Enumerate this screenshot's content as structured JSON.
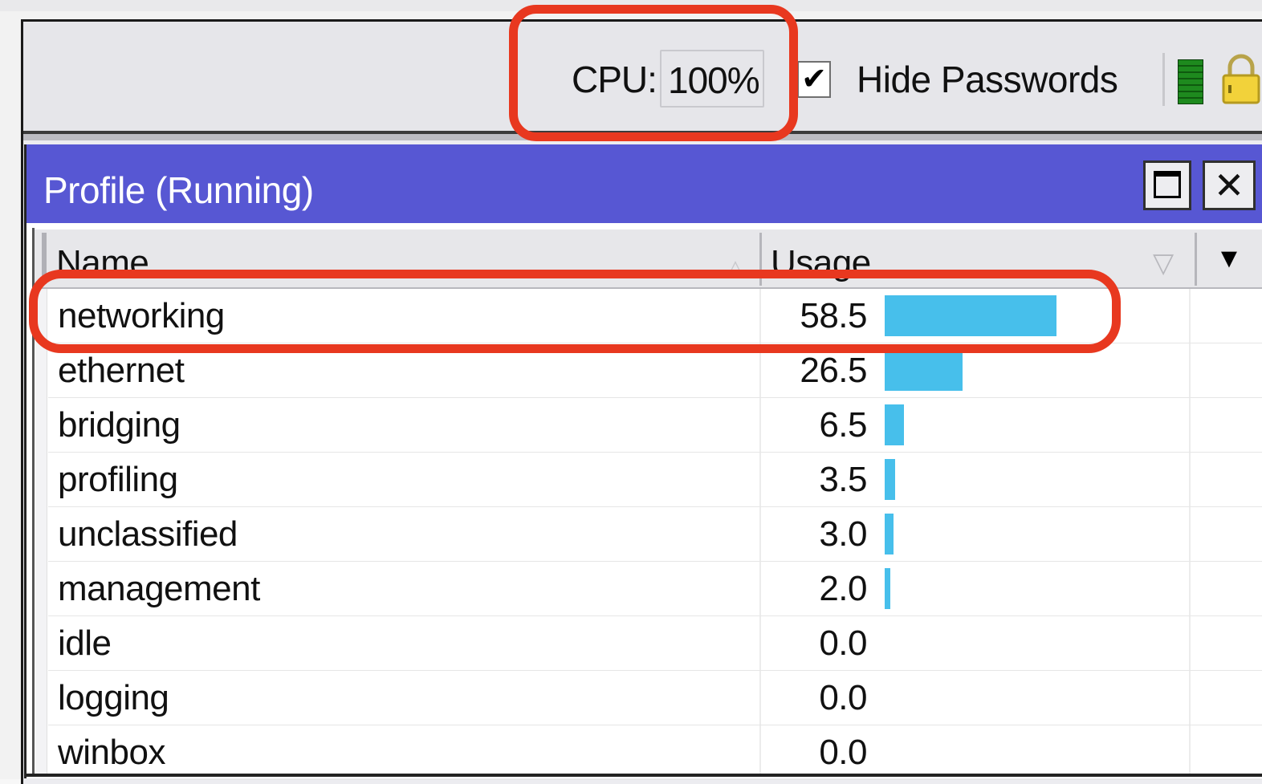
{
  "toolbar": {
    "cpu_label": "CPU:",
    "cpu_value": "100%",
    "hide_passwords_label": "Hide Passwords",
    "hide_passwords_checked": true,
    "check_glyph": "✔"
  },
  "window": {
    "title": "Profile (Running)",
    "close_glyph": "✕"
  },
  "table": {
    "columns": {
      "name": "Name",
      "usage": "Usage"
    },
    "col_menu_glyph": "▼",
    "sort_up_glyph": "△",
    "sort_down_glyph": "▽",
    "rows": [
      {
        "name": "networking",
        "usage": "58.5",
        "value": 58.5
      },
      {
        "name": "ethernet",
        "usage": "26.5",
        "value": 26.5
      },
      {
        "name": "bridging",
        "usage": "6.5",
        "value": 6.5
      },
      {
        "name": "profiling",
        "usage": "3.5",
        "value": 3.5
      },
      {
        "name": "unclassified",
        "usage": "3.0",
        "value": 3.0
      },
      {
        "name": "management",
        "usage": "2.0",
        "value": 2.0
      },
      {
        "name": "idle",
        "usage": "0.0",
        "value": 0.0
      },
      {
        "name": "logging",
        "usage": "0.0",
        "value": 0.0
      },
      {
        "name": "winbox",
        "usage": "0.0",
        "value": 0.0
      }
    ]
  },
  "colors": {
    "titlebar": "#5757d3",
    "usage_bar": "#47bfeb",
    "highlight": "#e8381f",
    "status_green": "#1e8a1e"
  },
  "icons": [
    "check-icon",
    "status-green-icon",
    "lock-icon",
    "maximize-icon",
    "close-icon",
    "sort-up-icon",
    "sort-down-icon",
    "column-menu-icon"
  ]
}
